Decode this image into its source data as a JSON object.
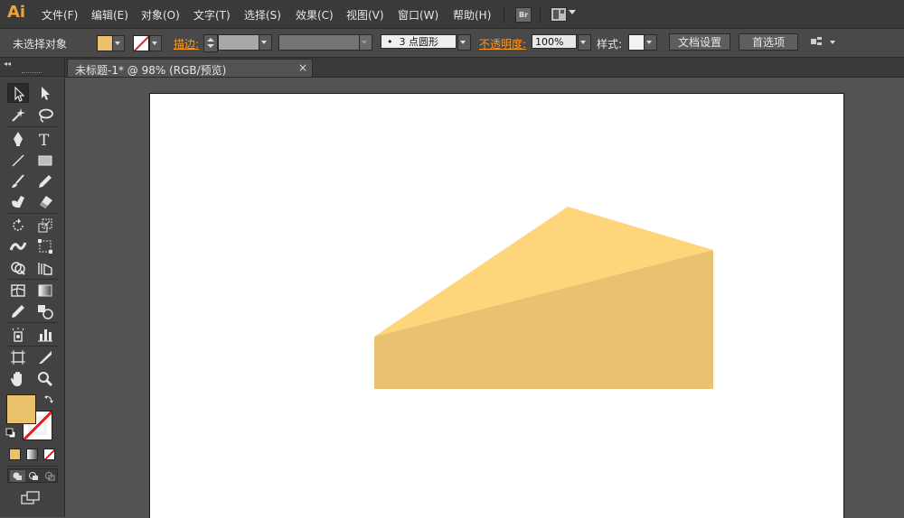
{
  "app": {
    "logo": "Ai",
    "menus": [
      "文件(F)",
      "编辑(E)",
      "对象(O)",
      "文字(T)",
      "选择(S)",
      "效果(C)",
      "视图(V)",
      "窗口(W)",
      "帮助(H)"
    ],
    "bridge_label": "Br"
  },
  "control": {
    "selection_status": "未选择对象",
    "stroke_label": "描边:",
    "brush_value": "3 点圆形",
    "opacity_label": "不透明度:",
    "opacity_value": "100%",
    "style_label": "样式:",
    "doc_settings_button": "文档设置",
    "preferences_button": "首选项"
  },
  "document": {
    "tab_label": "未标题-1* @ 98% (RGB/预览)",
    "close_glyph": "×"
  },
  "colors": {
    "fill": "#e9c26b",
    "stroke": "none",
    "shape_top": "#fed57b",
    "shape_front": "#e8c271",
    "accent": "#ff9a1a"
  },
  "tools": [
    "selection-tool",
    "direct-selection-tool",
    "magic-wand-tool",
    "lasso-tool",
    "pen-tool",
    "type-tool",
    "line-segment-tool",
    "rectangle-tool",
    "paintbrush-tool",
    "pencil-tool",
    "blob-brush-tool",
    "eraser-tool",
    "rotate-tool",
    "scale-tool",
    "width-tool",
    "free-transform-tool",
    "shape-builder-tool",
    "perspective-grid-tool",
    "mesh-tool",
    "gradient-tool",
    "eyedropper-tool",
    "blend-tool",
    "symbol-sprayer-tool",
    "column-graph-tool",
    "artboard-tool",
    "slice-tool",
    "hand-tool",
    "zoom-tool"
  ]
}
